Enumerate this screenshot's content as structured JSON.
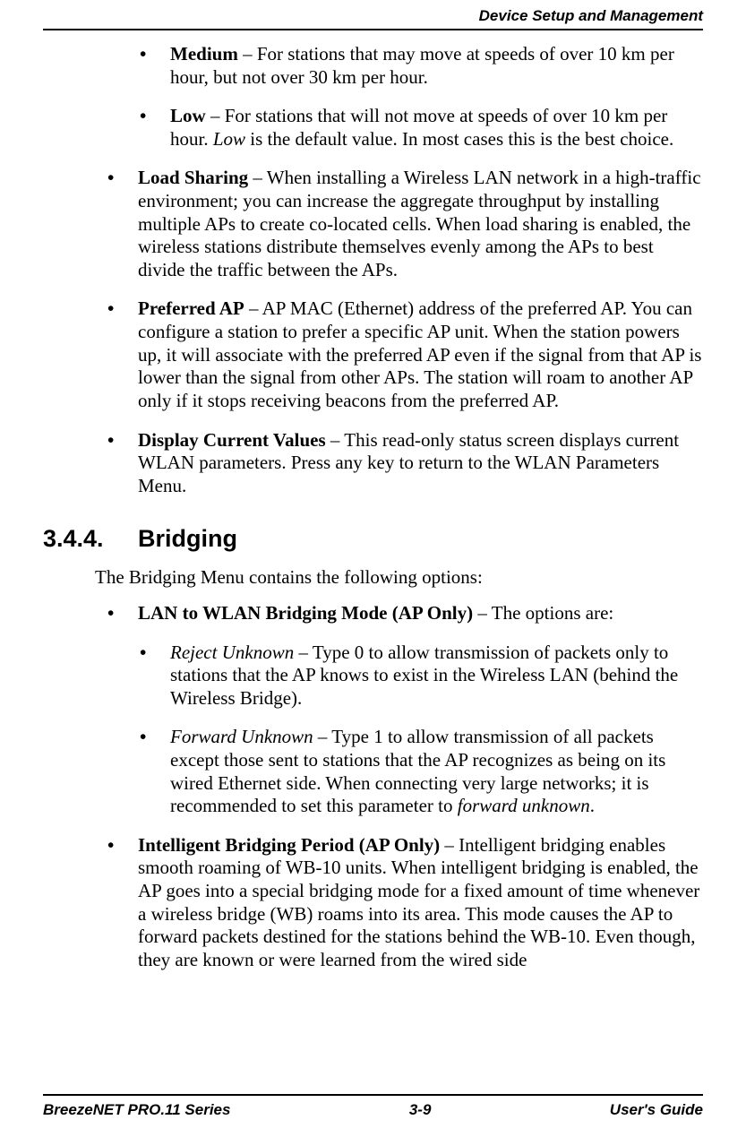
{
  "header": {
    "title": "Device Setup and Management"
  },
  "content": {
    "top_bullets_level2": [
      {
        "term": "Medium",
        "sep": " – ",
        "text": "For stations that may move at speeds of over 10 km per hour, but not over 30 km per hour."
      },
      {
        "term": "Low",
        "sep": "  – ",
        "text_pre": "For stations that will not move at speeds of over 10 km per hour. ",
        "text_italic": "Low",
        "text_post": " is the default value. In most cases this is the best choice."
      }
    ],
    "top_bullets_level1": [
      {
        "term": "Load Sharing",
        "sep": " – ",
        "text": "When installing a Wireless LAN network in a high-traffic environment; you can increase the aggregate throughput by installing multiple APs to create co-located cells. When load sharing is enabled, the wireless stations distribute themselves evenly among the APs to best divide the traffic between the APs."
      },
      {
        "term": "Preferred AP",
        "sep": " – ",
        "text": "AP MAC (Ethernet) address of the preferred AP. You can configure a station to prefer a specific AP unit. When the station powers up, it will associate with the preferred AP even if the signal from that AP is lower than the signal from other APs. The station will roam to another AP only if it stops receiving beacons from the preferred AP."
      },
      {
        "term": "Display Current Values",
        "sep": " – ",
        "text": "This read-only status screen displays current WLAN parameters. Press any key to return to the WLAN Parameters Menu."
      }
    ],
    "section": {
      "number": "3.4.4.",
      "title": "Bridging",
      "intro": "The Bridging Menu contains the following options:",
      "bullets_level1": [
        {
          "term": "LAN to WLAN Bridging Mode (AP Only)",
          "sep": " – ",
          "text": "The options are:",
          "sub": [
            {
              "term": "Reject Unknown",
              "term_style": "italic",
              "sep": " – ",
              "text": "Type 0 to allow transmission of packets only to stations that the AP knows to exist in the Wireless LAN (behind the Wireless Bridge)."
            },
            {
              "term": "Forward Unknown",
              "term_style": "italic",
              "sep": " – ",
              "text_pre": "Type 1 to allow transmission of all packets except those sent to stations that the AP recognizes as being on its wired Ethernet side. When connecting very large networks; it is recommended to set this parameter to ",
              "text_italic": "forward unknown",
              "text_post": "."
            }
          ]
        },
        {
          "term": "Intelligent Bridging Period (AP Only)",
          "sep": " – ",
          "text": "Intelligent bridging enables smooth roaming of WB-10 units. When intelligent bridging is enabled, the AP goes into a special bridging mode for a fixed amount of time whenever a wireless bridge (WB) roams into its area. This mode causes the AP to forward packets destined for the stations behind the WB-10. Even though, they are known or were learned from the wired side"
        }
      ]
    }
  },
  "footer": {
    "left": "BreezeNET PRO.11 Series",
    "center": "3-9",
    "right": "User's Guide"
  }
}
